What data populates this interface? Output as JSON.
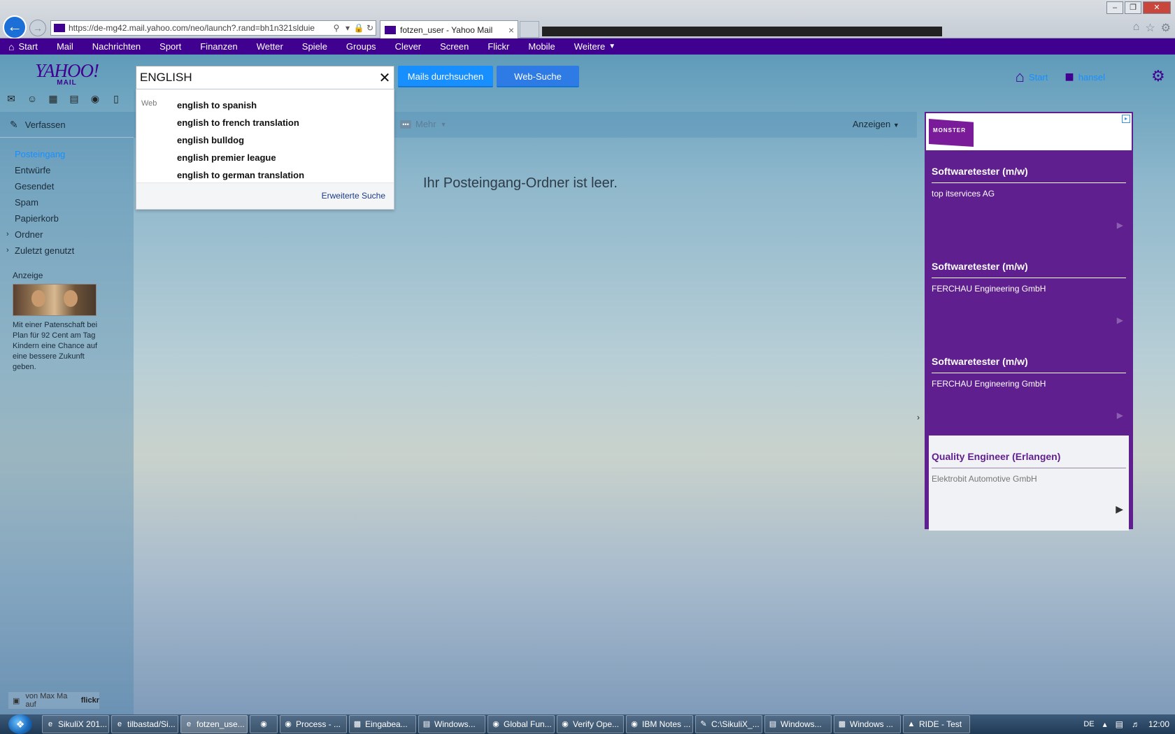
{
  "browser": {
    "url": "https://de-mg42.mail.yahoo.com/neo/launch?.rand=bh1n321slduie",
    "tab_title": "fotzen_user - Yahoo Mail",
    "tab_close": "×"
  },
  "nav": {
    "items": [
      "Start",
      "Mail",
      "Nachrichten",
      "Sport",
      "Finanzen",
      "Wetter",
      "Spiele",
      "Groups",
      "Clever",
      "Screen",
      "Flickr",
      "Mobile",
      "Weitere"
    ]
  },
  "header": {
    "logo_big": "YAHOO!",
    "logo_small": "MAIL",
    "search_value": "ENGLISH",
    "search_mails_label": "Mails durchsuchen",
    "web_search_label": "Web-Suche",
    "home_label": "Start",
    "user_label": "hansel"
  },
  "suggestions": {
    "web_label": "Web",
    "items": [
      "english to spanish",
      "english to french translation",
      "english bulldog",
      "english premier league",
      "english to german translation"
    ],
    "advanced_label": "Erweiterte Suche"
  },
  "sidebar": {
    "compose_label": "Verfassen",
    "folders": [
      {
        "label": "Posteingang",
        "active": true
      },
      {
        "label": "Entwürfe"
      },
      {
        "label": "Gesendet"
      },
      {
        "label": "Spam"
      },
      {
        "label": "Papierkorb"
      },
      {
        "label": "Ordner",
        "expandable": true
      },
      {
        "label": "Zuletzt genutzt",
        "expandable": true
      }
    ],
    "ad_label": "Anzeige",
    "ad_text": "Mit einer Patenschaft bei Plan für 92 Cent am Tag Kindern eine Chance auf eine bessere Zukunft geben.",
    "photo_credit": "von Max Ma auf",
    "photo_credit_brand": "flickr"
  },
  "main": {
    "more_label": "Mehr",
    "view_label": "Anzeigen",
    "empty_message": "Ihr Posteingang-Ordner ist leer."
  },
  "ads": {
    "brand": "MONSTER",
    "jobs": [
      {
        "title": "Softwaretester (m/w)",
        "company": "top itservices AG"
      },
      {
        "title": "Softwaretester (m/w)",
        "company": "FERCHAU Engineering GmbH"
      },
      {
        "title": "Softwaretester (m/w)",
        "company": "FERCHAU Engineering GmbH"
      },
      {
        "title": "Quality Engineer (Erlangen)",
        "company": "Elektrobit Automotive GmbH"
      }
    ]
  },
  "taskbar": {
    "items": [
      "SikuliX 201...",
      "tilbastad/Si...",
      "fotzen_use...",
      "",
      "Process - ...",
      "Eingabea...",
      "Windows...",
      "Global Fun...",
      "Verify Ope...",
      "IBM Notes ...",
      "C:\\SikuliX_...",
      "Windows...",
      "Windows ...",
      "RIDE - Test"
    ],
    "lang": "DE",
    "time": "12:00"
  },
  "colors": {
    "yahoo_purple": "#400090",
    "button_blue": "#188fff",
    "ad_purple": "#5f1f8e"
  }
}
